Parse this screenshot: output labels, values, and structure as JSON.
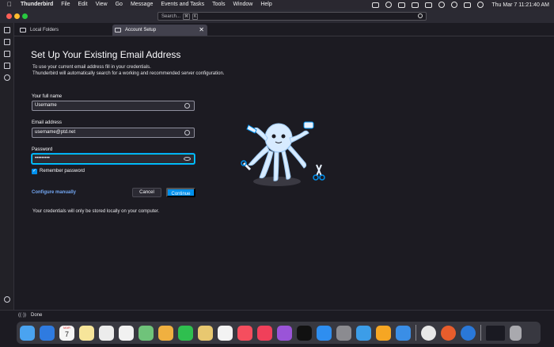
{
  "menubar": {
    "app_name": "Thunderbird",
    "items": [
      "File",
      "Edit",
      "View",
      "Go",
      "Message",
      "Events and Tasks",
      "Tools",
      "Window",
      "Help"
    ],
    "clock": "Thu Mar 7  11:21:40 AM"
  },
  "search": {
    "placeholder": "Search...",
    "shortcut_keys": [
      "⌘",
      "K"
    ]
  },
  "tabs": {
    "folders_label": "Local Folders",
    "setup_label": "Account Setup",
    "close_glyph": "✕"
  },
  "form": {
    "heading": "Set Up Your Existing Email Address",
    "description_line1": "To use your current email address fill in your credentials.",
    "description_line2": "Thunderbird will automatically search for a working and recommended server configuration.",
    "name_label": "Your full name",
    "name_value": "Username",
    "email_label": "Email address",
    "email_value": "username@ptd.net",
    "password_label": "Password",
    "password_value": "•••••••••",
    "remember_label": "Remember password",
    "remember_checked": true,
    "configure_link": "Configure manually",
    "cancel_label": "Cancel",
    "continue_label": "Continue",
    "footnote": "Your credentials will only be stored locally on your computer."
  },
  "status": {
    "text": "Done",
    "wave_glyph": "((·))"
  },
  "dock": {
    "calendar_month": "MAR",
    "calendar_day": "7"
  },
  "colors": {
    "accent": "#0090ed",
    "link": "#73a7f3",
    "background": "#1c1b22"
  }
}
